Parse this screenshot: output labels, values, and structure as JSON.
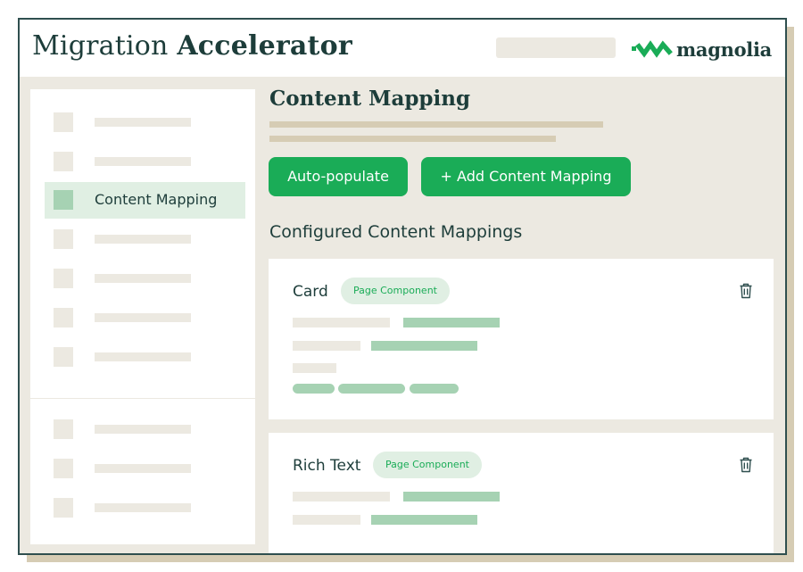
{
  "header": {
    "title_regular": "Migration",
    "title_bold": "Accelerator",
    "brand_name": "magnolia",
    "brand_icon": "magnolia-logo-icon"
  },
  "sidebar": {
    "items": [
      {
        "label": "",
        "active": false
      },
      {
        "label": "",
        "active": false
      },
      {
        "label": "Content Mapping",
        "active": true
      },
      {
        "label": "",
        "active": false
      },
      {
        "label": "",
        "active": false
      },
      {
        "label": "",
        "active": false
      },
      {
        "label": "",
        "active": false
      }
    ],
    "bottom_items": [
      {
        "label": ""
      },
      {
        "label": ""
      },
      {
        "label": ""
      }
    ]
  },
  "main": {
    "title": "Content Mapping",
    "buttons": {
      "auto_populate": "Auto-populate",
      "add_mapping": "+ Add Content Mapping"
    },
    "section_title": "Configured Content Mappings",
    "mappings": [
      {
        "name": "Card",
        "type": "Page Component",
        "delete_icon": "trash-icon"
      },
      {
        "name": "Rich Text",
        "type": "Page Component",
        "delete_icon": "trash-icon"
      }
    ]
  },
  "colors": {
    "brand_green": "#1aac57",
    "dark_teal": "#1d3d3a",
    "background_beige": "#ece9e1",
    "light_green": "#e0efe3",
    "placeholder_green": "#a6d2b3",
    "shadow_tan": "#d6ccb4"
  }
}
